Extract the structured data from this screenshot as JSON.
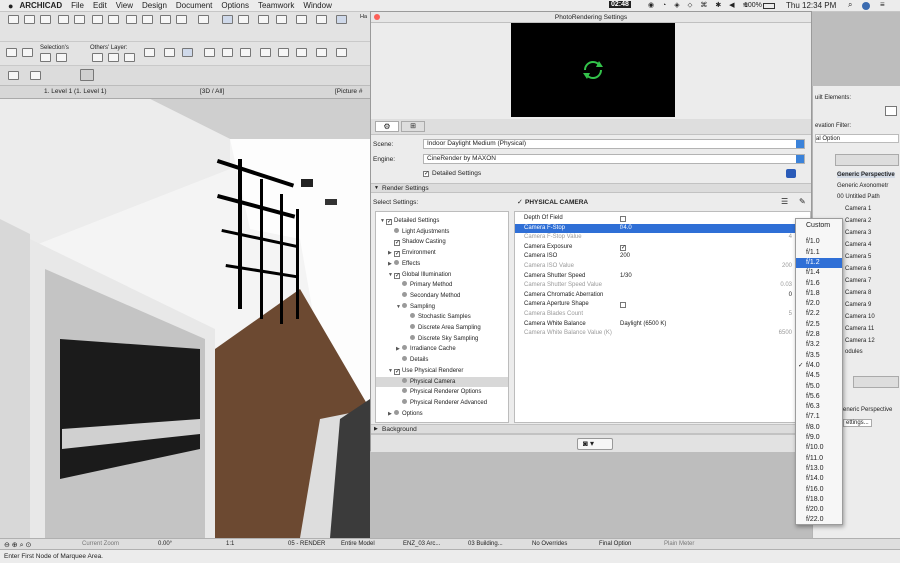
{
  "menubar": {
    "app": "ARCHICAD",
    "items": [
      "File",
      "Edit",
      "View",
      "Design",
      "Document",
      "Options",
      "Teamwork",
      "Window"
    ],
    "battery": "100%",
    "clock": "Thu 12:34 PM",
    "timer": "02:48"
  },
  "toolbar": {
    "selections_label": "Selection's",
    "others_layer_label": "Others' Layer:"
  },
  "tabs": {
    "floor": "1. Level 1 (1. Level 1)",
    "view3d": "[3D / All]",
    "picture": "[Picture #"
  },
  "dialog": {
    "title": "PhotoRendering Settings",
    "scene_label": "Scene:",
    "scene_value": "Indoor Daylight Medium (Physical)",
    "engine_label": "Engine:",
    "engine_value": "CineRender by MAXON",
    "detailed_settings_label": "Detailed Settings",
    "render_settings_label": "Render Settings",
    "select_settings_label": "Select Settings:",
    "physical_camera_header": "PHYSICAL CAMERA",
    "background_label": "Background"
  },
  "tree": [
    {
      "label": "Detailed Settings",
      "indent": 0,
      "arrow": "▼",
      "check": "on"
    },
    {
      "label": "Light Adjustments",
      "indent": 1,
      "arrow": "",
      "check": "dot"
    },
    {
      "label": "Shadow Casting",
      "indent": 1,
      "arrow": "",
      "check": "on"
    },
    {
      "label": "Environment",
      "indent": 1,
      "arrow": "▶",
      "check": "on"
    },
    {
      "label": "Effects",
      "indent": 1,
      "arrow": "▶",
      "check": "dot"
    },
    {
      "label": "Global Illumination",
      "indent": 1,
      "arrow": "▼",
      "check": "on"
    },
    {
      "label": "Primary Method",
      "indent": 2,
      "arrow": "",
      "check": "dot"
    },
    {
      "label": "Secondary Method",
      "indent": 2,
      "arrow": "",
      "check": "dot"
    },
    {
      "label": "Sampling",
      "indent": 2,
      "arrow": "▼",
      "check": "dot"
    },
    {
      "label": "Stochastic Samples",
      "indent": 3,
      "arrow": "",
      "check": "dot"
    },
    {
      "label": "Discrete Area Sampling",
      "indent": 3,
      "arrow": "",
      "check": "dot"
    },
    {
      "label": "Discrete Sky Sampling",
      "indent": 3,
      "arrow": "",
      "check": "dot"
    },
    {
      "label": "Irradiance Cache",
      "indent": 2,
      "arrow": "▶",
      "check": "dot"
    },
    {
      "label": "Details",
      "indent": 2,
      "arrow": "",
      "check": "dot"
    },
    {
      "label": "Use Physical Renderer",
      "indent": 1,
      "arrow": "▼",
      "check": "on"
    },
    {
      "label": "Physical Camera",
      "indent": 2,
      "arrow": "",
      "check": "dot",
      "selected": true
    },
    {
      "label": "Physical Renderer Options",
      "indent": 2,
      "arrow": "",
      "check": "dot"
    },
    {
      "label": "Physical Renderer Advanced",
      "indent": 2,
      "arrow": "",
      "check": "dot"
    },
    {
      "label": "Options",
      "indent": 1,
      "arrow": "▶",
      "check": "dot"
    }
  ],
  "props": [
    {
      "name": "Depth Of Field",
      "value": "",
      "right": "",
      "check": "off"
    },
    {
      "name": "Camera F-Stop",
      "value": "f/4.0",
      "right": "",
      "selected": true
    },
    {
      "name": "Camera F-Stop Value",
      "value": "",
      "right": "4",
      "disabled": true
    },
    {
      "name": "Camera Exposure",
      "value": "",
      "right": "",
      "check": "on"
    },
    {
      "name": "Camera ISO",
      "value": "200",
      "right": ""
    },
    {
      "name": "Camera ISO Value",
      "value": "",
      "right": "200",
      "disabled": true
    },
    {
      "name": "Camera Shutter Speed",
      "value": "1/30",
      "right": ""
    },
    {
      "name": "Camera Shutter Speed Value",
      "value": "",
      "right": "0.03",
      "disabled": true
    },
    {
      "name": "Camera Chromatic Aberration",
      "value": "",
      "right": "0"
    },
    {
      "name": "Camera Aperture Shape",
      "value": "",
      "right": "",
      "check": "off"
    },
    {
      "name": "Camera Blades Count",
      "value": "",
      "right": "5",
      "disabled": true
    },
    {
      "name": "Camera White Balance",
      "value": "Daylight (6500 K)",
      "right": ""
    },
    {
      "name": "Camera White Balance Value (K)",
      "value": "",
      "right": "6500",
      "disabled": true
    }
  ],
  "fstop_options": [
    "Custom",
    "f/1.0",
    "f/1.1",
    "f/1.2",
    "f/1.4",
    "f/1.6",
    "f/1.8",
    "f/2.0",
    "f/2.2",
    "f/2.5",
    "f/2.8",
    "f/3.2",
    "f/3.5",
    "f/4.0",
    "f/4.5",
    "f/5.0",
    "f/5.6",
    "f/6.3",
    "f/7.1",
    "f/8.0",
    "f/9.0",
    "f/10.0",
    "f/11.0",
    "f/13.0",
    "f/14.0",
    "f/16.0",
    "f/18.0",
    "f/20.0",
    "f/22.0"
  ],
  "fstop_highlighted": "f/1.2",
  "fstop_checked": "f/4.0",
  "rightpanel": {
    "built_elements": "uilt Elements:",
    "elevation_filter": "evation Filter:",
    "option": "al Option",
    "generic_perspective": "Generic Perspective",
    "generic_axonometry": "Generic Axonometr",
    "untitled_path": "00 Untitled Path",
    "cameras": [
      "Camera 1",
      "Camera 2",
      "Camera 3",
      "Camera 4",
      "Camera 5",
      "Camera 6",
      "Camera 7",
      "Camera 8",
      "Camera 9",
      "Camera 10",
      "Camera 11",
      "Camera 12"
    ],
    "modules": "odules",
    "generic_perspective2": "eneric Perspective",
    "settings": "ettings..."
  },
  "status": {
    "current_zoom": "Current Zoom",
    "angle": "0.00°",
    "scale": "1:1",
    "layer_combo": "05 - RENDER",
    "model": "Entire Model",
    "pen_set": "ENZ_03 Arc...",
    "building": "03 Building...",
    "overrides": "No Overrides",
    "option": "Final Option",
    "plain": "Plain Meter"
  },
  "hint": "Enter First Node of Marquee Area."
}
